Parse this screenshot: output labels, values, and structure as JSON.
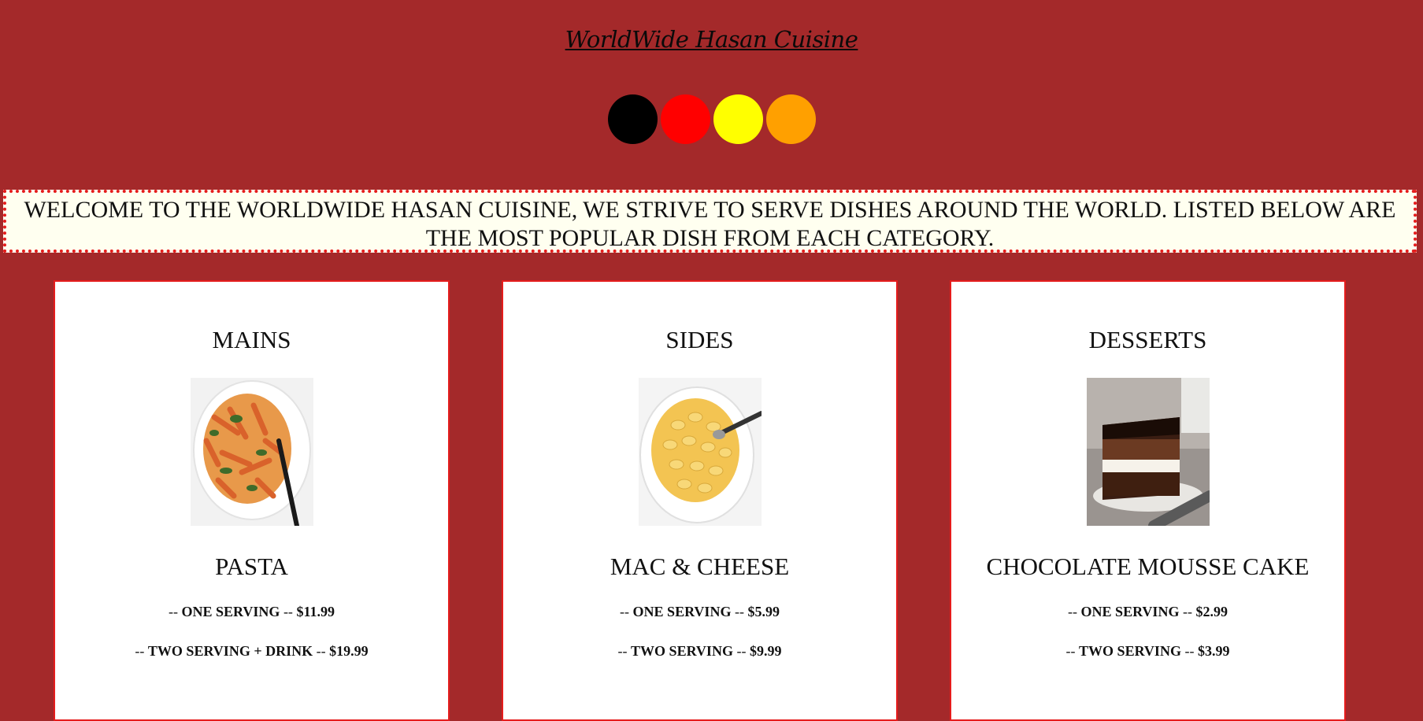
{
  "header": {
    "title": "WorldWide Hasan Cuisine"
  },
  "color_dots": [
    {
      "name": "black-dot",
      "color": "#000000"
    },
    {
      "name": "red-dot",
      "color": "#ff0000"
    },
    {
      "name": "yellow-dot",
      "color": "#ffff00"
    },
    {
      "name": "orange-dot",
      "color": "#ffa000"
    }
  ],
  "welcome": {
    "text": "WELCOME TO THE WORLDWIDE HASAN CUISINE, WE STRIVE TO SERVE DISHES AROUND THE WORLD. LISTED BELOW ARE THE MOST POPULAR DISH FROM EACH CATEGORY."
  },
  "cards": [
    {
      "category": "MAINS",
      "image": "pasta-image",
      "dish": "PASTA",
      "prices": [
        {
          "prefix": "-- ",
          "label": "ONE SERVING",
          "sep": " -- ",
          "price": "$11.99"
        },
        {
          "prefix": "-- ",
          "label": "TWO SERVING + DRINK",
          "sep": " -- ",
          "price": "$19.99"
        }
      ]
    },
    {
      "category": "SIDES",
      "image": "mac-and-cheese-image",
      "dish": "MAC & CHEESE",
      "prices": [
        {
          "prefix": "-- ",
          "label": "ONE SERVING",
          "sep": " -- ",
          "price": "$5.99"
        },
        {
          "prefix": "-- ",
          "label": "TWO SERVING",
          "sep": " -- ",
          "price": "$9.99"
        }
      ]
    },
    {
      "category": "DESSERTS",
      "image": "chocolate-mousse-cake-image",
      "dish": "CHOCOLATE MOUSSE CAKE",
      "prices": [
        {
          "prefix": "-- ",
          "label": "ONE SERVING",
          "sep": " -- ",
          "price": "$2.99"
        },
        {
          "prefix": "-- ",
          "label": "TWO SERVING",
          "sep": " -- ",
          "price": "$3.99"
        }
      ]
    }
  ],
  "colors": {
    "background": "#a4292a",
    "banner_bg": "#fffff0",
    "accent_border": "#e51c1c"
  }
}
